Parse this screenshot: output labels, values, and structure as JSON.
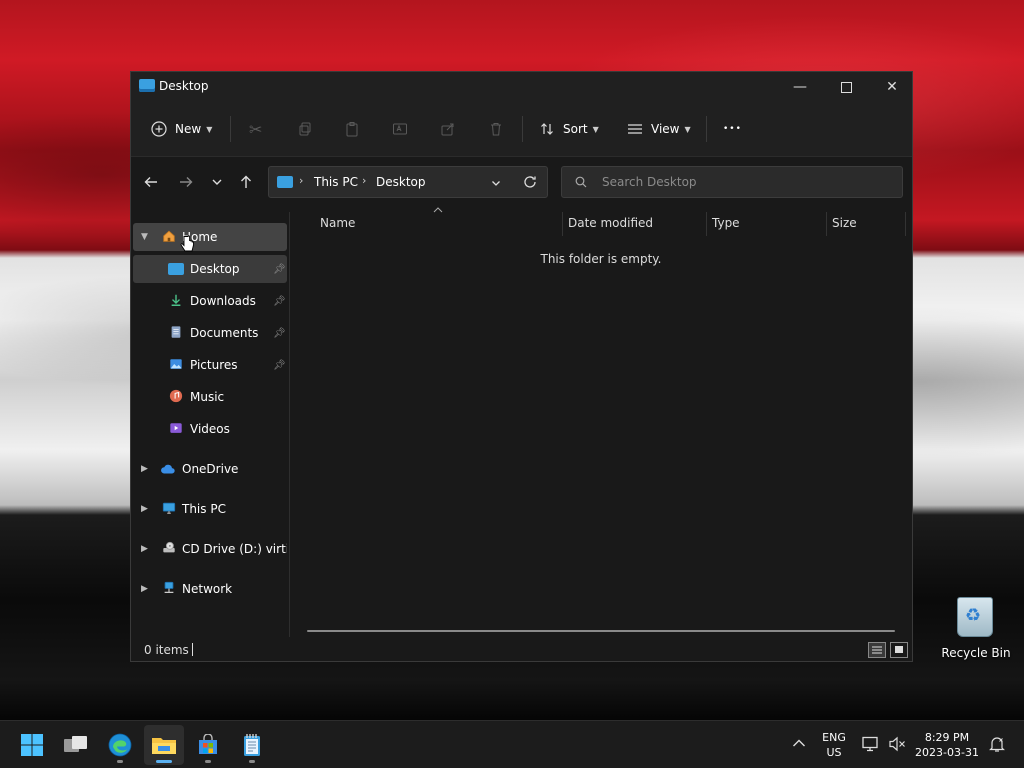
{
  "window": {
    "title": "Desktop",
    "min_glyph": "—",
    "close_glyph": "✕"
  },
  "toolbar": {
    "new_label": "New",
    "sort_label": "Sort",
    "view_label": "View",
    "more_glyph": "•••"
  },
  "address": {
    "parts": [
      "This PC",
      "Desktop"
    ],
    "search_placeholder": "Search Desktop"
  },
  "sidebar": {
    "home": "Home",
    "quick": [
      {
        "label": "Desktop",
        "pinned": true
      },
      {
        "label": "Downloads",
        "pinned": true
      },
      {
        "label": "Documents",
        "pinned": true
      },
      {
        "label": "Pictures",
        "pinned": true
      },
      {
        "label": "Music",
        "pinned": false
      },
      {
        "label": "Videos",
        "pinned": false
      }
    ],
    "roots": [
      "OneDrive",
      "This PC",
      "CD Drive (D:) virtio-w",
      "Network"
    ]
  },
  "columns": [
    "Name",
    "Date modified",
    "Type",
    "Size"
  ],
  "content": {
    "empty_message": "This folder is empty."
  },
  "status": {
    "items": "0 items"
  },
  "desktop": {
    "recycle_bin": "Recycle Bin"
  },
  "tray": {
    "lang_top": "ENG",
    "lang_bottom": "US",
    "time": "8:29 PM",
    "date": "2023-03-31"
  },
  "colors": {
    "accent": "#5ab0f0",
    "window_bg": "#191919",
    "toolbar_bg": "#202020"
  }
}
